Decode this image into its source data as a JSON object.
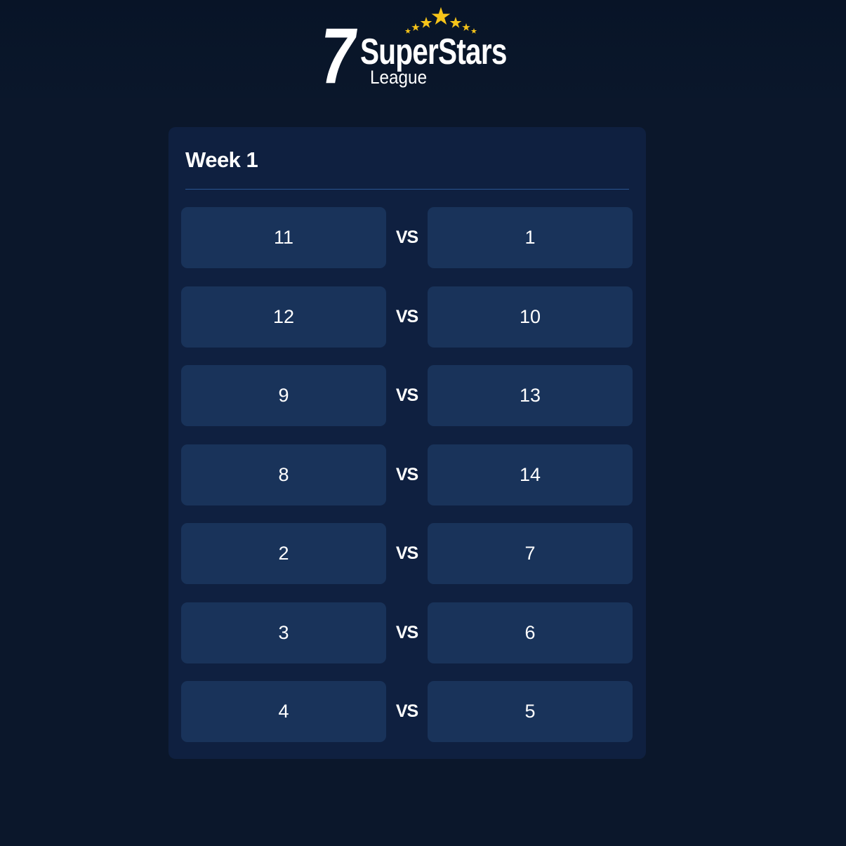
{
  "logo": {
    "number": "7",
    "name": "SuperStars",
    "sub": "League",
    "star_color": "#f6c419"
  },
  "schedule": {
    "title": "Week 1",
    "vs_label": "VS",
    "matches": [
      {
        "home": "11",
        "away": "1"
      },
      {
        "home": "12",
        "away": "10"
      },
      {
        "home": "9",
        "away": "13"
      },
      {
        "home": "8",
        "away": "14"
      },
      {
        "home": "2",
        "away": "7"
      },
      {
        "home": "3",
        "away": "6"
      },
      {
        "home": "4",
        "away": "5"
      }
    ]
  }
}
